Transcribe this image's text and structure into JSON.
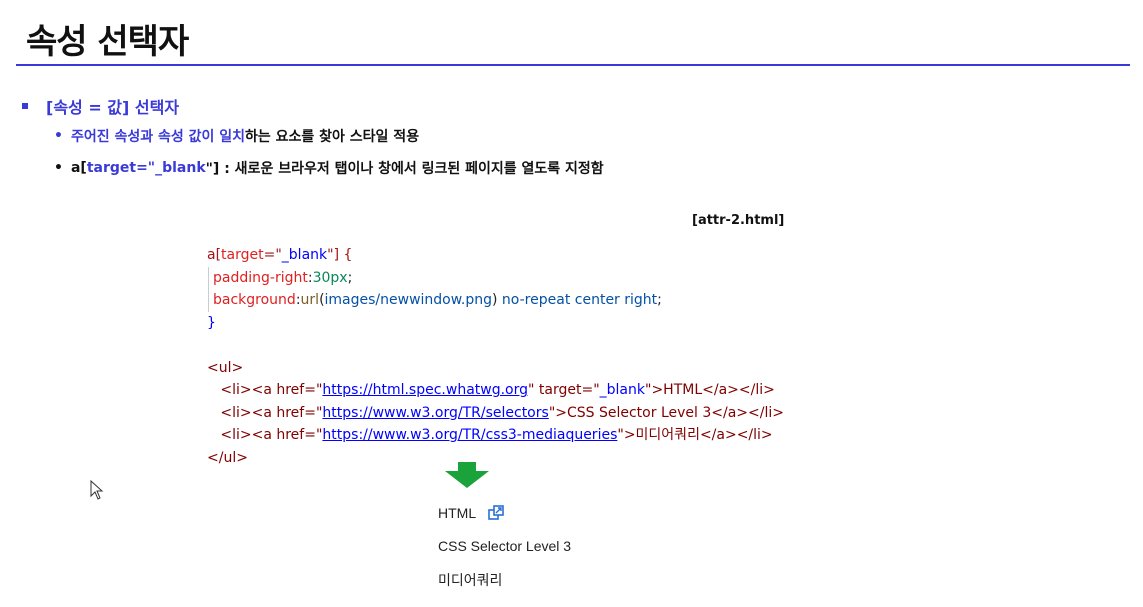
{
  "slide": {
    "title": "속성 선택자",
    "bullet1": "[속성 = 값] 선택자",
    "bullet2_blue": "주어진 속성과 속성 값이 일치",
    "bullet2_rest": "하는 요소를 찾아 스타일 적용",
    "bullet3_prefix": "a[",
    "bullet3_blue": "target=\"_blank",
    "bullet3_rest": "\"] : 새로운 브라우저 탭이나 창에서 링크된 페이지를 열도록 지정함",
    "filename": "[attr-2.html]"
  },
  "code": {
    "l1_sel": "a[",
    "l1_attr": "target",
    "l1_eq": "=\"",
    "l1_val": "_blank",
    "l1_end": "\"] {",
    "l2_prop": "padding-right",
    "l2_colon": ":",
    "l2_val": "30px",
    "l2_semi": ";",
    "l3_prop": "background",
    "l3_colon": ":",
    "l3_fn": "url",
    "l3_paren_open": "(",
    "l3_url": "images/newwindow.png",
    "l3_paren_close": ")",
    "l3_rest": " no-repeat center right",
    "l3_semi": ";",
    "l4": "}",
    "l6": "<ul>",
    "li1_open": "<li><a href=\"",
    "li1_href": "https://html.spec.whatwg.org",
    "li1_mid": "\" target=\"",
    "li1_target": "_blank",
    "li1_text": "\">HTML</a></li>",
    "li2_open": "<li><a href=\"",
    "li2_href": "https://www.w3.org/TR/selectors",
    "li2_text": "\">CSS Selector Level 3</a></li>",
    "li3_open": "<li><a href=\"",
    "li3_href": "https://www.w3.org/TR/css3-mediaqueries",
    "li3_text": "\">미디어쿼리</a></li>",
    "l_close": "</ul>"
  },
  "result": {
    "item1": "HTML",
    "item2": "CSS Selector Level 3",
    "item3": "미디어쿼리",
    "new_window_icon": "new-window-icon"
  },
  "colors": {
    "accent": "#3a3ad8",
    "arrow": "#1aa33a"
  }
}
